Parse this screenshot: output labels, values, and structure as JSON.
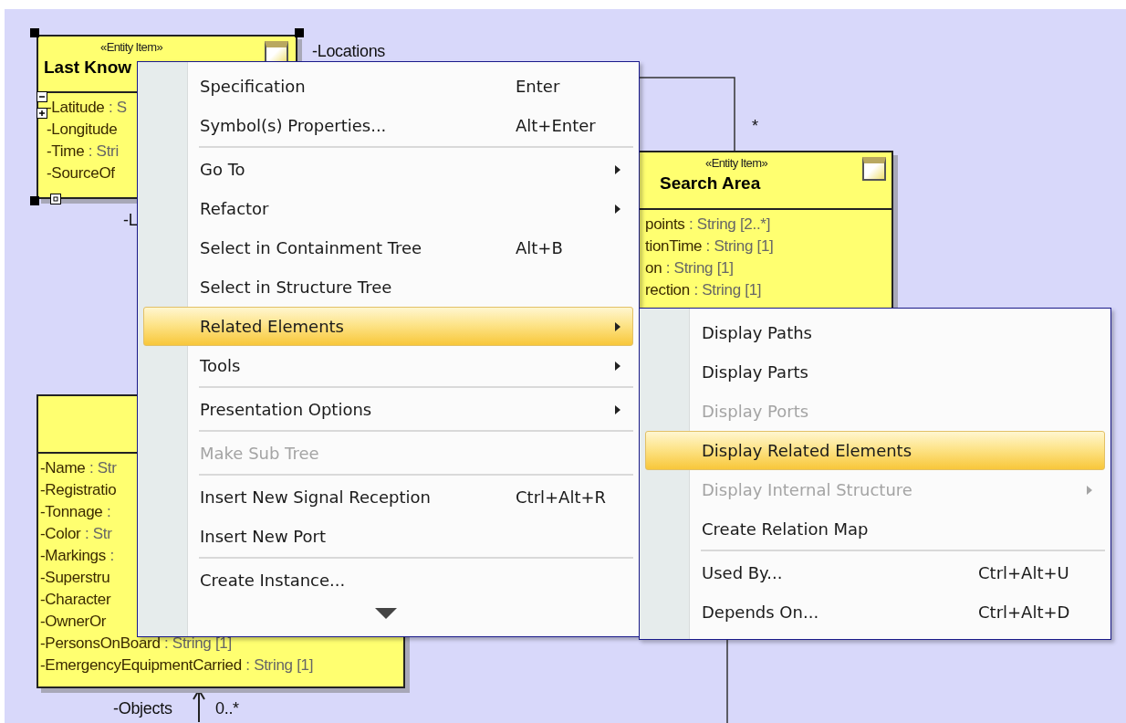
{
  "diagram": {
    "classes": [
      {
        "stereotype": "«Entity Item»",
        "name": "Last Know",
        "selected": true,
        "attributes": [
          {
            "name": "-Latitude",
            "type": ": S"
          },
          {
            "name": "-Longitude"
          },
          {
            "name": "-Time",
            "type": ": Stri"
          },
          {
            "name": "-SourceOf"
          }
        ]
      },
      {
        "stereotype": "«Entity Item»",
        "name": "Search Area",
        "selected": false,
        "attributes": [
          {
            "name": "points",
            "type": ": String [2..*]"
          },
          {
            "name": "tionTime",
            "type": ": String [1]"
          },
          {
            "name": "on",
            "type": ": String [1]"
          },
          {
            "name": "rection",
            "type": ": String [1]"
          }
        ]
      },
      {
        "selected": false,
        "attributes": [
          {
            "name": "-Name",
            "type": ": Str"
          },
          {
            "name": "-Registratio"
          },
          {
            "name": "-Tonnage",
            "type": ":"
          },
          {
            "name": "-Color",
            "type": ": Str"
          },
          {
            "name": "-Markings",
            "type": ":"
          },
          {
            "name": "-Superstru"
          },
          {
            "name": "-Character"
          },
          {
            "name": "-OwnerOr"
          },
          {
            "name": "-PersonsOnBoard",
            "type": ": String [1]"
          },
          {
            "name": "-EmergencyEquipmentCarried",
            "type": ": String [1]"
          }
        ]
      }
    ],
    "labels": [
      "-Locations",
      "*",
      "-L",
      "-Objects",
      "0..*"
    ]
  },
  "context_menu": {
    "items": [
      {
        "kind": "item",
        "label": "Specification",
        "shortcut": "Enter",
        "submenu": false,
        "disabled": false,
        "selected": false
      },
      {
        "kind": "item",
        "label": "Symbol(s) Properties...",
        "shortcut": "Alt+Enter",
        "submenu": false,
        "disabled": false,
        "selected": false
      },
      {
        "kind": "separator"
      },
      {
        "kind": "item",
        "label": "Go To",
        "submenu": true,
        "disabled": false,
        "selected": false
      },
      {
        "kind": "item",
        "label": "Refactor",
        "submenu": true,
        "disabled": false,
        "selected": false
      },
      {
        "kind": "item",
        "label": "Select in Containment Tree",
        "shortcut": "Alt+B",
        "submenu": false,
        "disabled": false,
        "selected": false
      },
      {
        "kind": "item",
        "label": "Select in Structure Tree",
        "submenu": false,
        "disabled": false,
        "selected": false
      },
      {
        "kind": "item",
        "label": "Related Elements",
        "submenu": true,
        "disabled": false,
        "selected": true
      },
      {
        "kind": "item",
        "label": "Tools",
        "submenu": true,
        "disabled": false,
        "selected": false
      },
      {
        "kind": "separator"
      },
      {
        "kind": "item",
        "label": "Presentation Options",
        "submenu": true,
        "disabled": false,
        "selected": false
      },
      {
        "kind": "separator"
      },
      {
        "kind": "item",
        "label": "Make Sub Tree",
        "submenu": false,
        "disabled": true,
        "selected": false
      },
      {
        "kind": "separator"
      },
      {
        "kind": "item",
        "label": "Insert New Signal Reception",
        "shortcut": "Ctrl+Alt+R",
        "submenu": false,
        "disabled": false,
        "selected": false
      },
      {
        "kind": "item",
        "label": "Insert New Port",
        "submenu": false,
        "disabled": false,
        "selected": false
      },
      {
        "kind": "separator"
      },
      {
        "kind": "item",
        "label": "Create Instance...",
        "submenu": false,
        "disabled": false,
        "selected": false
      }
    ]
  },
  "submenu": {
    "items": [
      {
        "kind": "item",
        "label": "Display Paths",
        "submenu": false,
        "disabled": false,
        "selected": false
      },
      {
        "kind": "item",
        "label": "Display Parts",
        "submenu": false,
        "disabled": false,
        "selected": false
      },
      {
        "kind": "item",
        "label": "Display Ports",
        "submenu": false,
        "disabled": true,
        "selected": false
      },
      {
        "kind": "item",
        "label": "Display Related Elements",
        "submenu": false,
        "disabled": false,
        "selected": true
      },
      {
        "kind": "item",
        "label": "Display Internal Structure",
        "submenu": true,
        "disabled": true,
        "selected": false
      },
      {
        "kind": "item",
        "label": "Create Relation Map",
        "submenu": false,
        "disabled": false,
        "selected": false
      },
      {
        "kind": "separator"
      },
      {
        "kind": "item",
        "label": "Used By...",
        "shortcut": "Ctrl+Alt+U",
        "submenu": false,
        "disabled": false,
        "selected": false
      },
      {
        "kind": "item",
        "label": "Depends On...",
        "shortcut": "Ctrl+Alt+D",
        "submenu": false,
        "disabled": false,
        "selected": false
      }
    ]
  }
}
